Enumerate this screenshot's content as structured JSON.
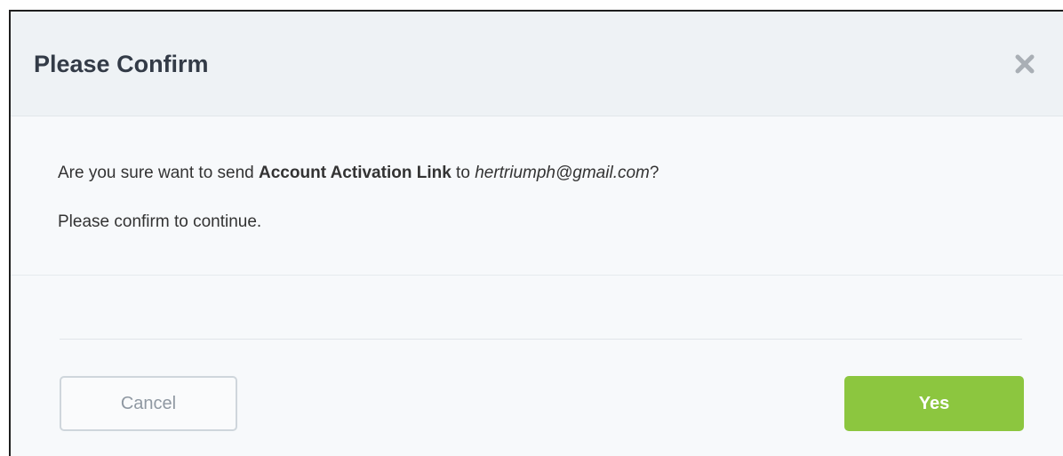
{
  "dialog": {
    "title": "Please Confirm",
    "close_icon": "close-icon",
    "message": {
      "prefix": "Are you sure want to send ",
      "bold": "Account Activation Link",
      "middle": " to ",
      "email": "hertriumph@gmail.com",
      "suffix": "?"
    },
    "sub_message": "Please confirm to continue.",
    "cancel_label": "Cancel",
    "yes_label": "Yes"
  },
  "colors": {
    "accent": "#8cc63f",
    "title": "#333b47",
    "header_bg": "#eef2f5"
  }
}
